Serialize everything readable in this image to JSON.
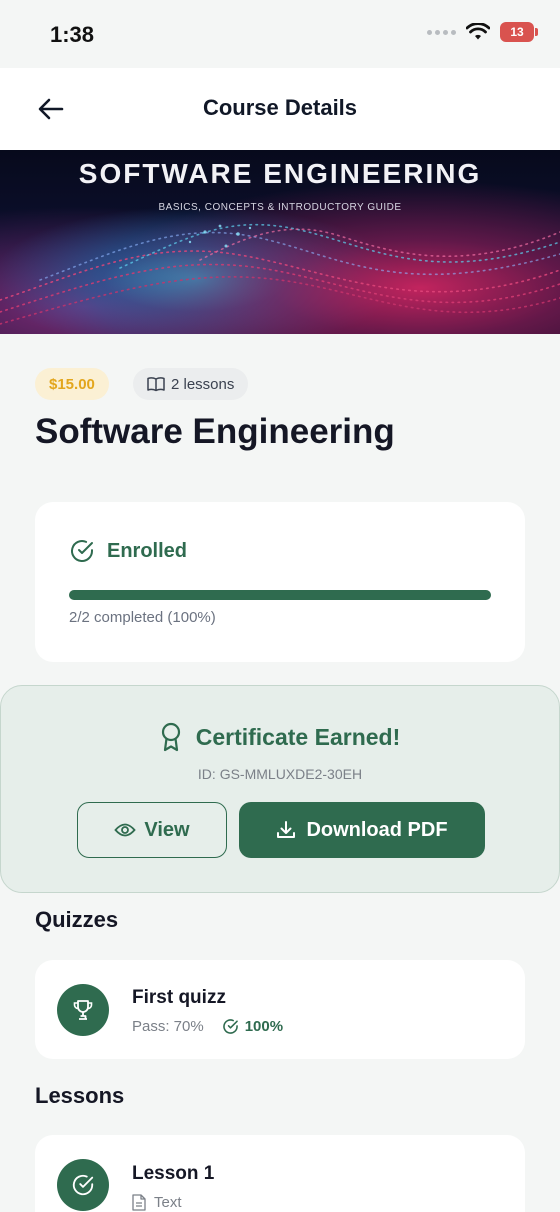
{
  "status_bar": {
    "time": "1:38",
    "battery": "13"
  },
  "header": {
    "title": "Course Details",
    "back_icon": "arrow-left-icon"
  },
  "banner": {
    "title": "SOFTWARE ENGINEERING",
    "subtitle": "BASICS, CONCEPTS & INTRODUCTORY GUIDE"
  },
  "course": {
    "price": "$15.00",
    "lessons_count": "2 lessons",
    "lessons_icon": "book-open-icon",
    "title": "Software Engineering"
  },
  "enrollment": {
    "status_label": "Enrolled",
    "status_icon": "check-circle-icon",
    "progress_fraction": 1.0,
    "progress_text": "2/2 completed (100%)"
  },
  "certificate": {
    "title": "Certificate Earned!",
    "icon": "award-ribbon-icon",
    "id_text": "ID: GS-MMLUXDE2-30EH",
    "view_label": "View",
    "download_label": "Download PDF"
  },
  "quizzes": {
    "heading": "Quizzes",
    "items": [
      {
        "title": "First quizz",
        "pass_text": "Pass: 70%",
        "score": "100%",
        "icon": "trophy-icon"
      }
    ]
  },
  "lessons": {
    "heading": "Lessons",
    "items": [
      {
        "title": "Lesson 1",
        "type": "Text",
        "icon": "check-circle-icon"
      }
    ]
  },
  "colors": {
    "accent": "#2f6b4f",
    "price_text": "#e3a61d",
    "price_bg": "#fbf0d4",
    "background": "#f4f6f5",
    "certificate_bg": "#e6eeea"
  }
}
